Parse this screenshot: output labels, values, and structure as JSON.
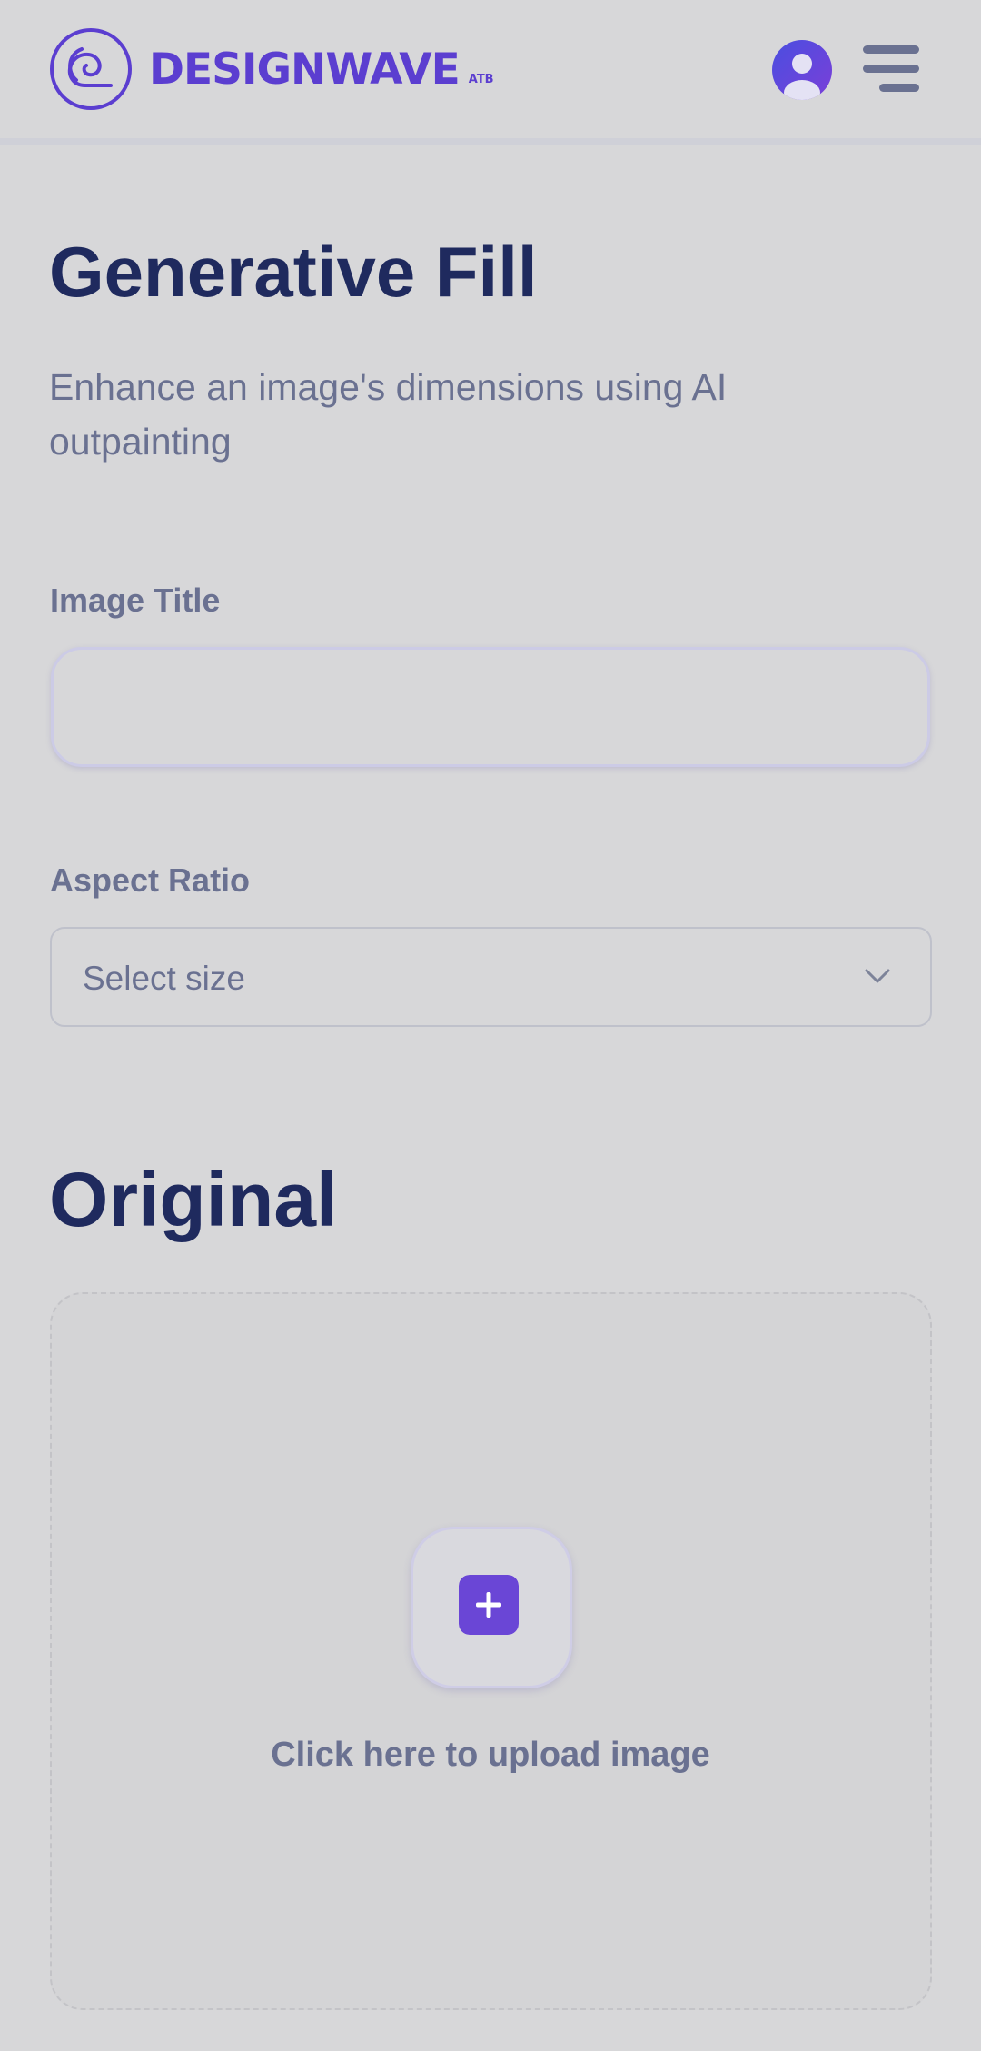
{
  "header": {
    "brand_name": "DESIGNWAVE",
    "brand_suffix": "ATB",
    "icons": [
      "wave-logo-icon",
      "user-avatar-icon",
      "hamburger-menu-icon"
    ]
  },
  "page": {
    "title": "Generative Fill",
    "subtitle": "Enhance an image's dimensions using AI outpainting"
  },
  "form": {
    "image_title_label": "Image Title",
    "image_title_value": "",
    "aspect_ratio_label": "Aspect Ratio",
    "aspect_ratio_selected": "Select size"
  },
  "original": {
    "title": "Original",
    "upload_label": "Click here to upload image"
  },
  "colors": {
    "brand": "#5b3ed0",
    "heading": "#1f2a5e",
    "muted_text": "#6a7191",
    "background": "#d7d7d9"
  }
}
